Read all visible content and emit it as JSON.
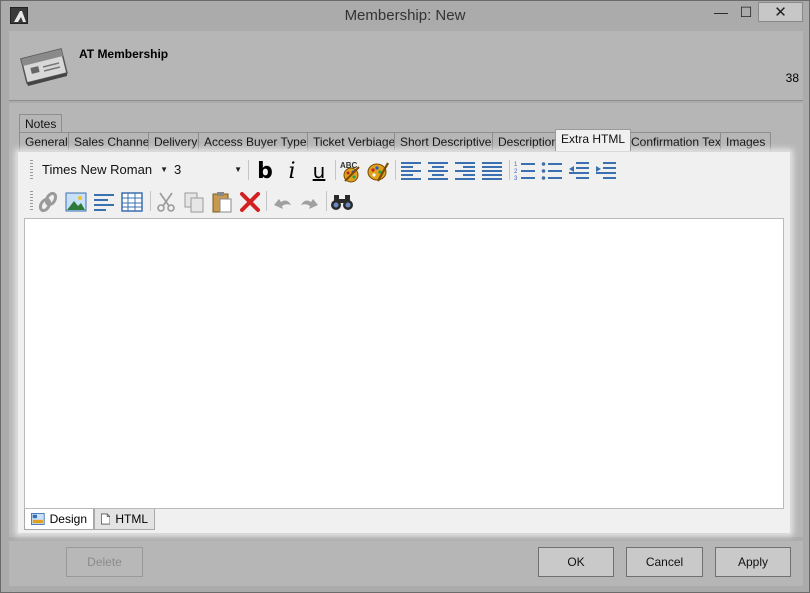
{
  "window": {
    "title": "Membership: New",
    "controls": {
      "minimize": "—",
      "maximize": "☐",
      "close": "✕"
    }
  },
  "header": {
    "name": "AT Membership",
    "id": "38"
  },
  "tabs": {
    "row1": [
      {
        "label": "Notes"
      }
    ],
    "row2": [
      {
        "label": "General"
      },
      {
        "label": "Sales Channel"
      },
      {
        "label": "Delivery"
      },
      {
        "label": "Access Buyer Types"
      },
      {
        "label": "Ticket Verbiage"
      },
      {
        "label": "Short Descriptives"
      },
      {
        "label": "Description"
      },
      {
        "label": "Extra HTML"
      },
      {
        "label": "Confirmation Text"
      },
      {
        "label": "Images"
      }
    ],
    "active": "Extra HTML"
  },
  "editor": {
    "font_family": "Times New Roman",
    "font_size": "3",
    "bold_label": "b",
    "italic_label": "i",
    "underline_label": "u",
    "spell_label": "ABC",
    "content": "",
    "mode_tabs": [
      {
        "label": "Design"
      },
      {
        "label": "HTML"
      }
    ],
    "active_mode": "Design"
  },
  "footer": {
    "delete_label": "Delete",
    "ok_label": "OK",
    "cancel_label": "Cancel",
    "apply_label": "Apply"
  },
  "colors": {
    "chrome": "#ababab",
    "panel": "#b6b6b6",
    "editor_bg": "#ffffff",
    "toolbar_bg": "#f0f0f0",
    "icon_blue": "#3a6fb0",
    "delete_red": "#d42020"
  }
}
